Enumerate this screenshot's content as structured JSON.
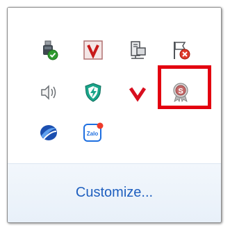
{
  "tray_overflow": {
    "icons": [
      {
        "name": "usb-safely-remove-icon"
      },
      {
        "name": "v-antivirus-tile-icon"
      },
      {
        "name": "network-icon"
      },
      {
        "name": "action-center-flag-error-icon"
      },
      {
        "name": "speaker-volume-icon"
      },
      {
        "name": "shield-lightning-icon"
      },
      {
        "name": "red-v-icon"
      },
      {
        "name": "s-badge-icon"
      },
      {
        "name": "blue-swirl-icon"
      },
      {
        "name": "zalo-icon",
        "label": "Zalo"
      }
    ],
    "customize_label": "Customize..."
  },
  "colors": {
    "link": "#1e5fbf",
    "highlight": "#e3000f",
    "footer_bg": "#eef4fb"
  }
}
